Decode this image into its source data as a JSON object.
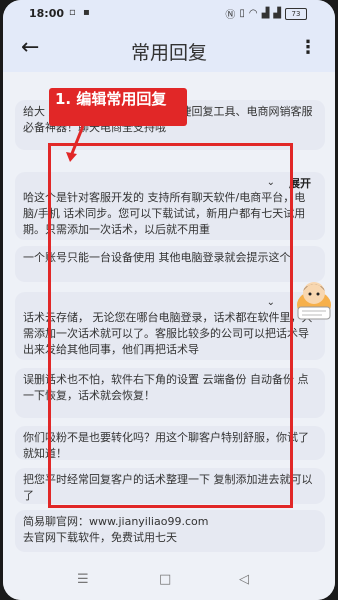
{
  "status_bar": {
    "time": "18:00",
    "battery": "73"
  },
  "app_bar": {
    "title": "常用回复"
  },
  "annotation": {
    "label": "1. 编辑常用回复"
  },
  "replies": [
    {
      "text": "给大家推荐一款比较好用的回复话术管理软件、跨平台快捷回复工具、电商网销客服必备神器！聊天电商全支持哦",
      "display": "给大           服话术管理软件、跨平台快捷回复工具、电商网销客服必备神器！聊天电商全支持哦"
    },
    {
      "text": "哈这个是针对客服开发的 支持所有聊天软件/电商平台，电脑/手机 话术同步。您可以下载试试，新用户都有七天试用期。只需添加一次话术，以后就不用重",
      "expand": "展开"
    },
    {
      "text": "一个账号只能一台设备使用 其他电脑登录就会提示这个"
    },
    {
      "text": "话术云存储， 无论您在哪台电脑登录，话术都在软件里，只需添加一次话术就可以了。客服比较多的公司可以把话术导出来发给其他同事，他们再把话术导"
    },
    {
      "text": "误删话术也不怕，软件右下角的设置 云端备份 自动备份 点一下恢复，话术就会恢复！"
    },
    {
      "text": "你们吸粉不是也要转化吗？用这个聊客户特别舒服，你试了就知道！"
    },
    {
      "text": "把您平时经常回复客户的话术整理一下 复制添加进去就可以了"
    }
  ],
  "footer": {
    "line1": "简易聊官网：www.jianyiliao99.com",
    "line2": "去官网下载软件，免费试用七天"
  },
  "colors": {
    "accent": "#e12727",
    "card": "#e6e9f2",
    "bar": "#e3eaf9"
  }
}
